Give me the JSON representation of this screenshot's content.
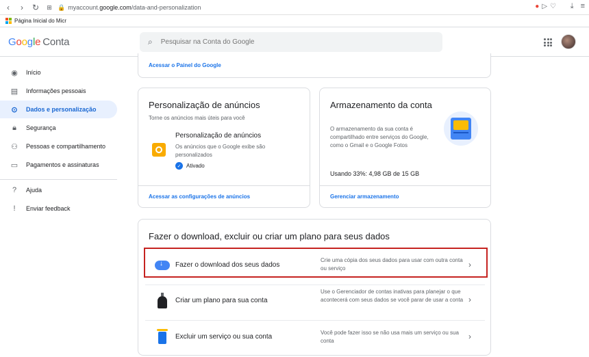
{
  "browser": {
    "url_prefix": "myaccount.",
    "url_host": "google.com",
    "url_path": "/data-and-personalization",
    "bookmark": "Página Inicial do Micr"
  },
  "header": {
    "brand_google": [
      "G",
      "o",
      "o",
      "g",
      "l",
      "e"
    ],
    "brand_conta": "Conta",
    "search_placeholder": "Pesquisar na Conta do Google"
  },
  "sidebar": {
    "items": [
      {
        "label": "Início",
        "icon": "home-icon"
      },
      {
        "label": "Informações pessoais",
        "icon": "id-card-icon"
      },
      {
        "label": "Dados e personalização",
        "icon": "toggle-icon",
        "active": true
      },
      {
        "label": "Segurança",
        "icon": "lock-icon"
      },
      {
        "label": "Pessoas e compartilhamento",
        "icon": "people-icon"
      },
      {
        "label": "Pagamentos e assinaturas",
        "icon": "card-icon"
      }
    ],
    "bottom": [
      {
        "label": "Ajuda",
        "icon": "help-icon"
      },
      {
        "label": "Enviar feedback",
        "icon": "feedback-icon"
      }
    ]
  },
  "top_card": {
    "link": "Acessar o Painel do Google"
  },
  "ads_card": {
    "title": "Personalização de anúncios",
    "subtitle": "Torne os anúncios mais úteis para você",
    "item_title": "Personalização de anúncios",
    "item_desc": "Os anúncios que o Google exibe são personalizados",
    "status": "Ativado",
    "link": "Acessar as configurações de anúncios"
  },
  "storage_card": {
    "title": "Armazenamento da conta",
    "desc": "O armazenamento da sua conta é compartilhado entre serviços do Google, como o Gmail e o Google Fotos",
    "usage": "Usando 33%: 4,98 GB de 15 GB",
    "link": "Gerenciar armazenamento"
  },
  "download_card": {
    "title": "Fazer o download, excluir ou criar um plano para seus dados",
    "rows": [
      {
        "label": "Fazer o download dos seus dados",
        "desc": "Crie uma cópia dos seus dados para usar com outra conta ou serviço"
      },
      {
        "label": "Criar um plano para sua conta",
        "desc": "Use o Gerenciador de contas inativas para planejar o que acontecerá com seus dados se você parar de usar a conta"
      },
      {
        "label": "Excluir um serviço ou sua conta",
        "desc": "Você pode fazer isso se não usa mais um serviço ou sua conta"
      }
    ]
  },
  "colors": {
    "accent": "#1a73e8",
    "highlight": "#c5221f",
    "active_bg": "#e8f0fe"
  }
}
